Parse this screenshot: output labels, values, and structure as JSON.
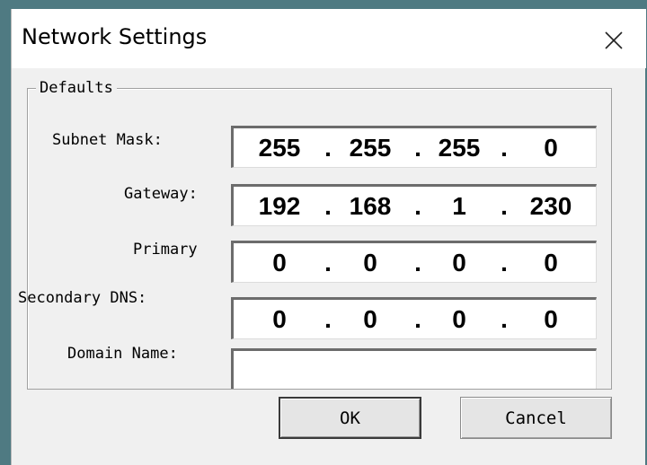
{
  "window": {
    "title": "Network Settings",
    "close_icon": "close-icon"
  },
  "group": {
    "legend": "Defaults"
  },
  "fields": {
    "subnet_mask": {
      "label": "Subnet Mask:",
      "octets": [
        "255",
        "255",
        "255",
        "0"
      ]
    },
    "gateway": {
      "label": "Gateway:",
      "octets": [
        "192",
        "168",
        "1",
        "230"
      ]
    },
    "primary_dns": {
      "label": "Primary",
      "octets": [
        "0",
        "0",
        "0",
        "0"
      ]
    },
    "secondary_dns": {
      "label": "Secondary DNS:",
      "octets": [
        "0",
        "0",
        "0",
        "0"
      ]
    },
    "domain_name": {
      "label": "Domain Name:",
      "value": ""
    }
  },
  "buttons": {
    "ok": "OK",
    "cancel": "Cancel"
  },
  "colors": {
    "dialog_bg": "#f0f0f0",
    "titlebar_bg": "#ffffff",
    "desktop_bg": "#4f7a82"
  }
}
